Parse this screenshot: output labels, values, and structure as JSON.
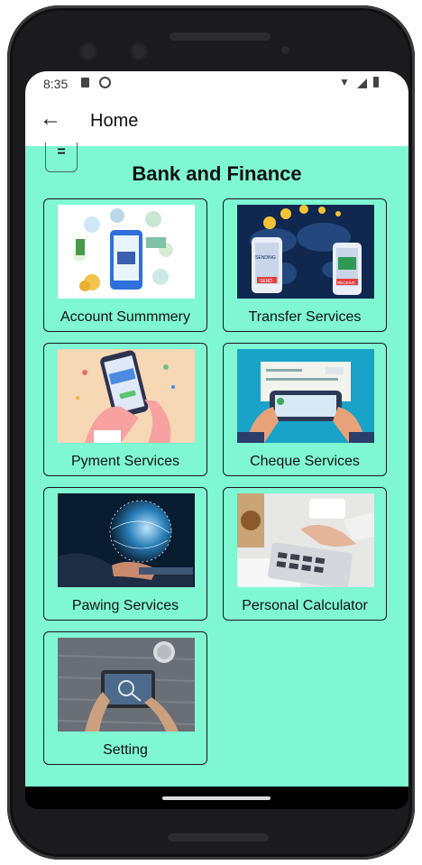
{
  "status_bar": {
    "time": "8:35"
  },
  "app_bar": {
    "back_icon": "arrow-left-icon",
    "title": "Home"
  },
  "menu_icon": "menu-icon",
  "heading": "Bank and Finance",
  "cards": [
    {
      "label": "Account Summmery"
    },
    {
      "label": "Transfer Services",
      "image_text": {
        "sending": "SENDING",
        "send": "SEND",
        "receive": "RECEIVE"
      }
    },
    {
      "label": "Pyment Services"
    },
    {
      "label": "Cheque Services"
    },
    {
      "label": "Pawing Services"
    },
    {
      "label": "Personal Calculator"
    },
    {
      "label": "Setting"
    }
  ],
  "colors": {
    "content_background": "#7ff7d2",
    "app_bar": "#ffffff"
  }
}
